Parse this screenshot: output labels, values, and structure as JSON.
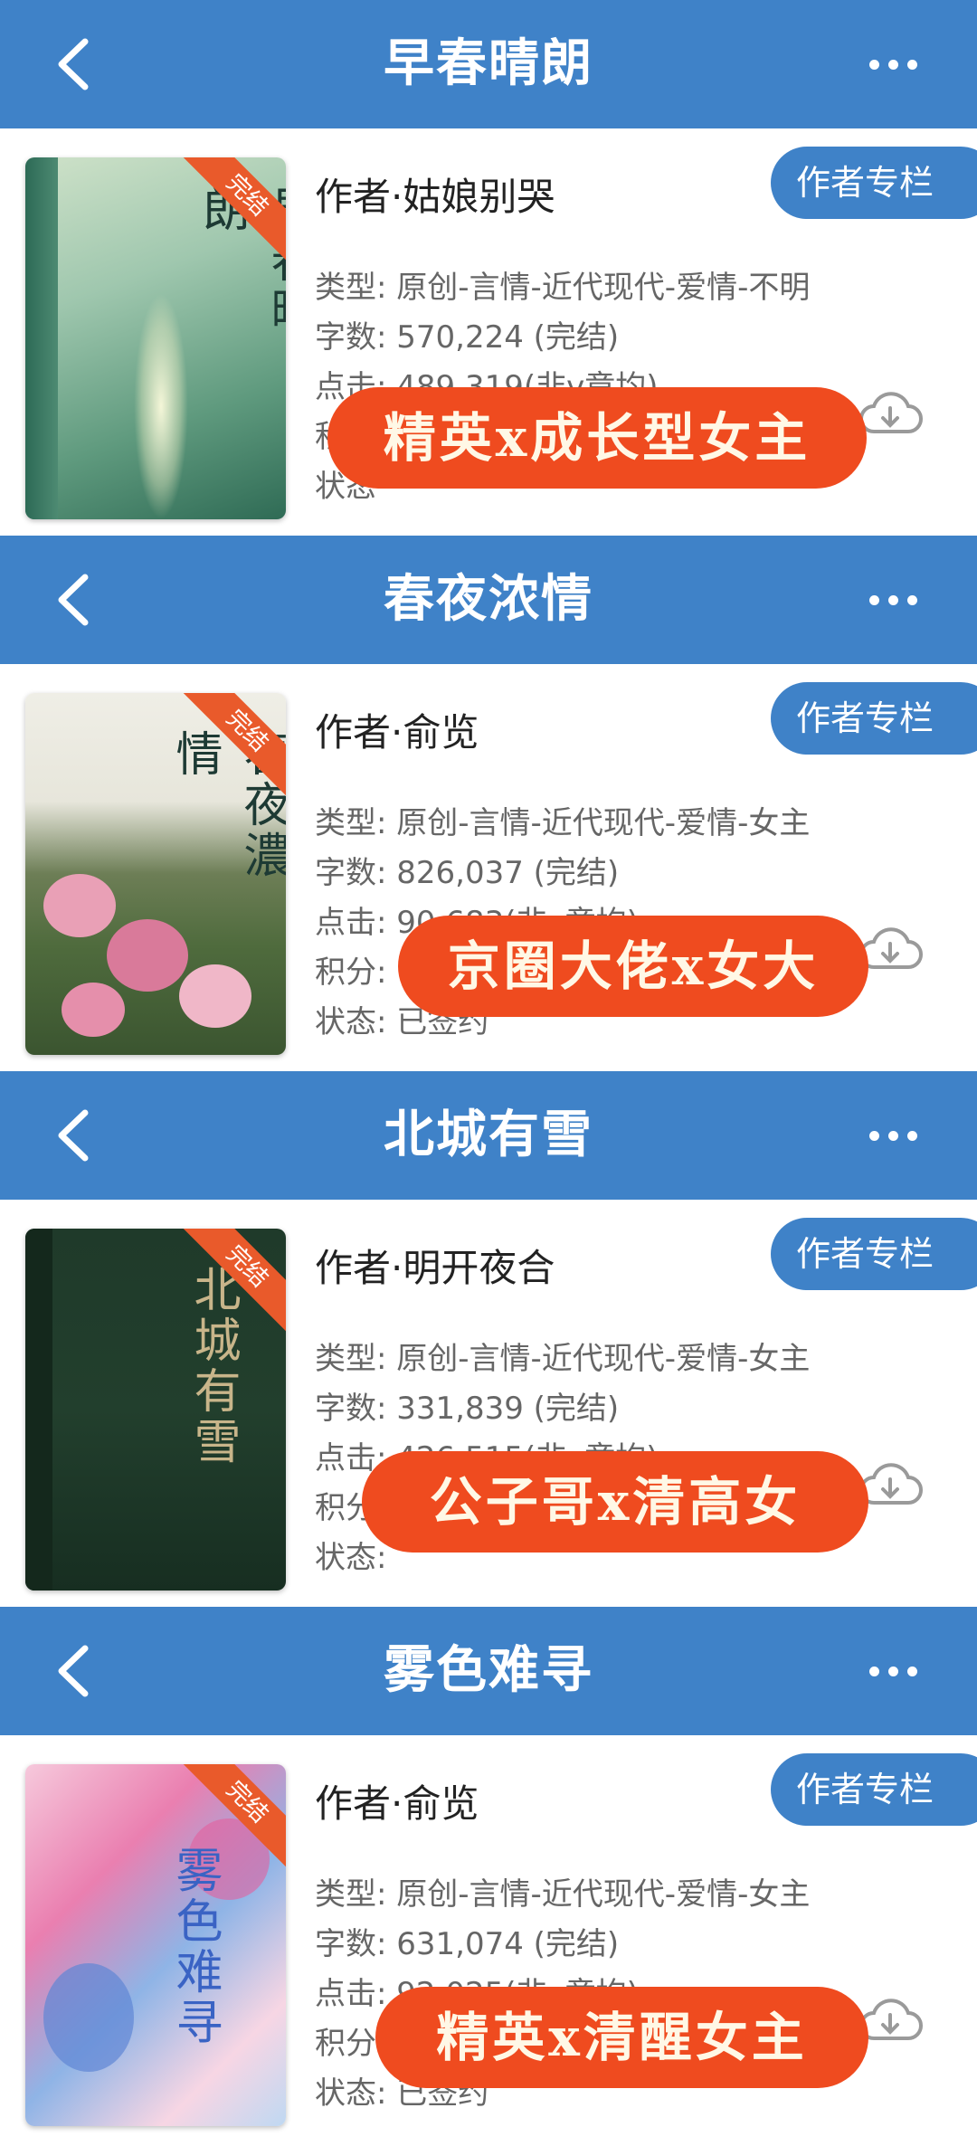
{
  "colors": {
    "header": "#3f82c8",
    "ribbon": "#e95a2b",
    "sticker": "#ef4b1f"
  },
  "icons": {
    "back": "chevron-left-icon",
    "more": "more-dots-icon",
    "download": "cloud-download-icon"
  },
  "column_button_label": "作者专栏",
  "ribbon_label": "完结",
  "books": [
    {
      "title": "早春晴朗",
      "author": "作者·姑娘别哭",
      "type": "类型: 原创-言情-近代现代-爱情-不明",
      "words": "字数: 570,224 (完结)",
      "clicks": "点击: 489,319(非v章均)",
      "score": "积",
      "status": "状态",
      "sticker": "精英x成长型女主",
      "cover_title": "早春晴朗"
    },
    {
      "title": "春夜浓情",
      "author": "作者·俞览",
      "type": "类型: 原创-言情-近代现代-爱情-女主",
      "words": "字数: 826,037 (完结)",
      "clicks": "点击: 90,683(非v章均)",
      "score": "积分:",
      "status": "状态: 已签约",
      "sticker": "京圈大佬x女大",
      "cover_title": "春夜濃情"
    },
    {
      "title": "北城有雪",
      "author": "作者·明开夜合",
      "type": "类型: 原创-言情-近代现代-爱情-女主",
      "words": "字数: 331,839 (完结)",
      "clicks": "点击: 426,515(非v章均)",
      "score": "积分",
      "status": "状态:",
      "sticker": "公子哥x清高女",
      "cover_title": "北城有雪"
    },
    {
      "title": "雾色难寻",
      "author": "作者·俞览",
      "type": "类型: 原创-言情-近代现代-爱情-女主",
      "words": "字数: 631,074 (完结)",
      "clicks": "点击: 92,025(非v章均)",
      "score": "积分",
      "status": "状态: 已签约",
      "sticker": "精英x清醒女主",
      "cover_title": "雾色难寻"
    }
  ]
}
